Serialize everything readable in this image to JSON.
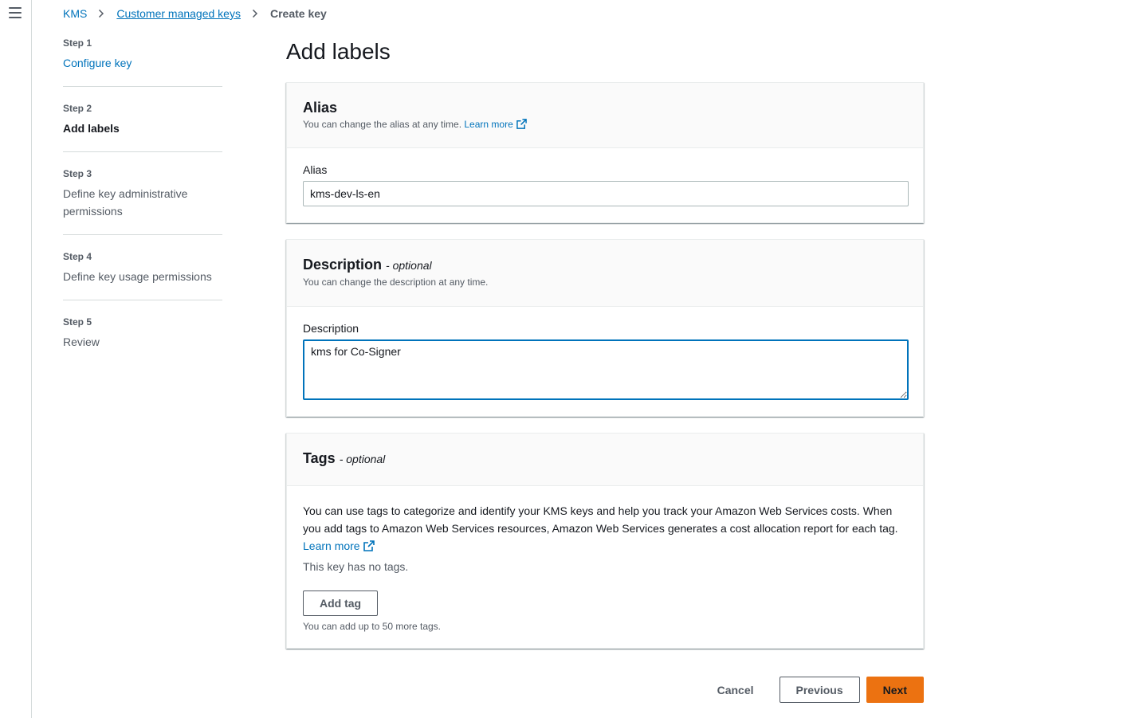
{
  "nav": {
    "menu_icon": "hamburger-menu-icon"
  },
  "breadcrumb": {
    "items": [
      "KMS",
      "Customer managed keys"
    ],
    "current": "Create key",
    "separator_icon": "chevron-right-icon"
  },
  "steps": [
    {
      "num": "Step 1",
      "title": "Configure key",
      "state": "link"
    },
    {
      "num": "Step 2",
      "title": "Add labels",
      "state": "active"
    },
    {
      "num": "Step 3",
      "title": "Define key administrative permissions",
      "state": "disabled"
    },
    {
      "num": "Step 4",
      "title": "Define key usage permissions",
      "state": "disabled"
    },
    {
      "num": "Step 5",
      "title": "Review",
      "state": "disabled"
    }
  ],
  "page": {
    "title": "Add labels"
  },
  "alias_panel": {
    "title": "Alias",
    "description": "You can change the alias at any time.",
    "learn_more": "Learn more",
    "field_label": "Alias",
    "value": "kms-dev-ls-en"
  },
  "description_panel": {
    "title": "Description",
    "optional": "- optional",
    "description": "You can change the description at any time.",
    "field_label": "Description",
    "value": "kms for Co-Signer"
  },
  "tags_panel": {
    "title": "Tags",
    "optional": "- optional",
    "text": "You can use tags to categorize and identify your KMS keys and help you track your Amazon Web Services costs. When you add tags to Amazon Web Services resources, Amazon Web Services generates a cost allocation report for each tag.",
    "learn_more": "Learn more",
    "empty": "This key has no tags.",
    "add_button": "Add tag",
    "hint": "You can add up to 50 more tags."
  },
  "actions": {
    "cancel": "Cancel",
    "previous": "Previous",
    "next": "Next"
  },
  "colors": {
    "link": "#0073bb",
    "primary": "#ec7211",
    "text": "#16191f",
    "muted": "#545b64"
  }
}
